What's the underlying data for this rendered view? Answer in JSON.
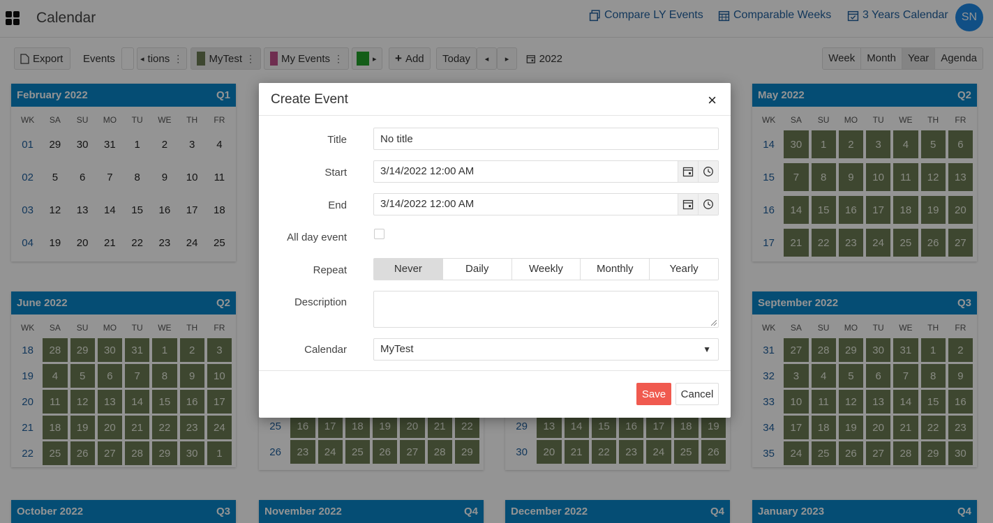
{
  "header": {
    "title": "Calendar",
    "links": [
      {
        "label": "Compare LY Events",
        "icon": "copy-calendar-icon"
      },
      {
        "label": "Comparable Weeks",
        "icon": "calendar-grid-icon"
      },
      {
        "label": "3 Years Calendar",
        "icon": "calendar-check-icon"
      }
    ],
    "avatar": "SN"
  },
  "toolbar": {
    "export_label": "Export",
    "events_label": "Events",
    "calendars": [
      {
        "label": "tions",
        "color": ""
      },
      {
        "label": "MyTest",
        "color": "#6b7b53"
      },
      {
        "label": "My Events",
        "color": "#c0508a"
      },
      {
        "label": "",
        "color": "#22a02a"
      }
    ],
    "add_label": "Add",
    "today_label": "Today",
    "prev": "◂",
    "next": "▸",
    "year_label": "2022",
    "views": [
      "Week",
      "Month",
      "Year",
      "Agenda"
    ],
    "active_view": "Year"
  },
  "calendar": {
    "day_headers": [
      "WK",
      "SA",
      "SU",
      "MO",
      "TU",
      "WE",
      "TH",
      "FR"
    ],
    "months": [
      {
        "name": "February 2022",
        "quarter": "Q1",
        "weeks": [
          [
            "01",
            "29",
            "30",
            "31",
            "1",
            "2",
            "3",
            "4"
          ],
          [
            "02",
            "5",
            "6",
            "7",
            "8",
            "9",
            "10",
            "11"
          ],
          [
            "03",
            "12",
            "13",
            "14",
            "15",
            "16",
            "17",
            "18"
          ],
          [
            "04",
            "19",
            "20",
            "21",
            "22",
            "23",
            "24",
            "25"
          ]
        ],
        "event": false
      },
      {
        "name": "May 2022",
        "quarter": "Q2",
        "weeks": [
          [
            "14",
            "30",
            "1",
            "2",
            "3",
            "4",
            "5",
            "6"
          ],
          [
            "15",
            "7",
            "8",
            "9",
            "10",
            "11",
            "12",
            "13"
          ],
          [
            "16",
            "14",
            "15",
            "16",
            "17",
            "18",
            "19",
            "20"
          ],
          [
            "17",
            "21",
            "22",
            "23",
            "24",
            "25",
            "26",
            "27"
          ]
        ],
        "event": true
      },
      {
        "name": "June 2022",
        "quarter": "Q2",
        "weeks": [
          [
            "18",
            "28",
            "29",
            "30",
            "31",
            "1",
            "2",
            "3"
          ],
          [
            "19",
            "4",
            "5",
            "6",
            "7",
            "8",
            "9",
            "10"
          ],
          [
            "20",
            "11",
            "12",
            "13",
            "14",
            "15",
            "16",
            "17"
          ],
          [
            "21",
            "18",
            "19",
            "20",
            "21",
            "22",
            "23",
            "24"
          ],
          [
            "22",
            "25",
            "26",
            "27",
            "28",
            "29",
            "30",
            "1"
          ]
        ],
        "event": true
      },
      {
        "name": "September 2022",
        "quarter": "Q3",
        "weeks": [
          [
            "31",
            "27",
            "28",
            "29",
            "30",
            "31",
            "1",
            "2"
          ],
          [
            "32",
            "3",
            "4",
            "5",
            "6",
            "7",
            "8",
            "9"
          ],
          [
            "33",
            "10",
            "11",
            "12",
            "13",
            "14",
            "15",
            "16"
          ],
          [
            "34",
            "17",
            "18",
            "19",
            "20",
            "21",
            "22",
            "23"
          ],
          [
            "35",
            "24",
            "25",
            "26",
            "27",
            "28",
            "29",
            "30"
          ]
        ],
        "event": true
      },
      {
        "name": "",
        "quarter": "",
        "weeks": [
          [
            "25",
            "16",
            "17",
            "18",
            "19",
            "20",
            "21",
            "22"
          ],
          [
            "26",
            "23",
            "24",
            "25",
            "26",
            "27",
            "28",
            "29"
          ]
        ],
        "event": true
      },
      {
        "name": "",
        "quarter": "",
        "weeks": [
          [
            "29",
            "13",
            "14",
            "15",
            "16",
            "17",
            "18",
            "19"
          ],
          [
            "30",
            "20",
            "21",
            "22",
            "23",
            "24",
            "25",
            "26"
          ]
        ],
        "event": true
      },
      {
        "name": "October 2022",
        "quarter": "Q3",
        "weeks": [],
        "event": false
      },
      {
        "name": "November 2022",
        "quarter": "Q4",
        "weeks": [],
        "event": false
      },
      {
        "name": "December 2022",
        "quarter": "Q4",
        "weeks": [],
        "event": false
      },
      {
        "name": "January 2023",
        "quarter": "Q4",
        "weeks": [],
        "event": false
      }
    ]
  },
  "dialog": {
    "title": "Create Event",
    "close": "×",
    "title_label": "Title",
    "title_value": "No title",
    "start_label": "Start",
    "start_value": "3/14/2022 12:00 AM",
    "end_label": "End",
    "end_value": "3/14/2022 12:00 AM",
    "allday_label": "All day event",
    "repeat_label": "Repeat",
    "repeat_options": [
      "Never",
      "Daily",
      "Weekly",
      "Monthly",
      "Yearly"
    ],
    "repeat_selected": "Never",
    "description_label": "Description",
    "calendar_label": "Calendar",
    "calendar_value": "MyTest",
    "save_label": "Save",
    "cancel_label": "Cancel"
  }
}
